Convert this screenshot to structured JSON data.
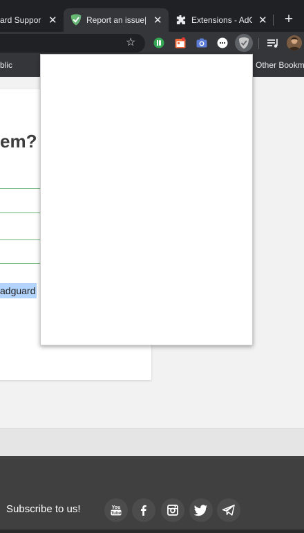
{
  "browser": {
    "tabs": [
      {
        "title": "ard Suppor",
        "close": "✕"
      },
      {
        "title": "Report an issue|",
        "close": "✕"
      },
      {
        "title": "Extensions - AdG",
        "close": "✕"
      }
    ],
    "new_tab": "+"
  },
  "bookmarks_bar": {
    "left_item": "blic",
    "right_item": "Other Bookm"
  },
  "page": {
    "heading": "em?",
    "selected_text": "adguard",
    "accent_color": "#67b279",
    "selection_color": "#b3d4fd"
  },
  "footer": {
    "subscribe_label": "Subscribe to us!",
    "social_icons": [
      "youtube-icon",
      "facebook-icon",
      "instagram-icon",
      "twitter-icon",
      "telegram-icon"
    ]
  }
}
